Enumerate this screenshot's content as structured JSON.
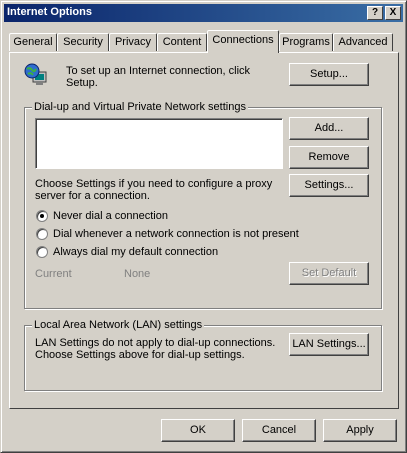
{
  "window": {
    "title": "Internet Options",
    "help_btn": "?",
    "close_btn": "X"
  },
  "tabs": [
    "General",
    "Security",
    "Privacy",
    "Content",
    "Connections",
    "Programs",
    "Advanced"
  ],
  "active_tab": "Connections",
  "setup": {
    "text": "To set up an Internet connection, click Setup.",
    "line1": "To set up an Internet connection, click",
    "line2": "Setup.",
    "button": "Setup...",
    "icon": "globe-computer-icon"
  },
  "dialup": {
    "group_label": "Dial-up and Virtual Private Network settings",
    "buttons": {
      "add": "Add...",
      "remove": "Remove",
      "settings": "Settings...",
      "set_default": "Set Default"
    },
    "choose_line1": "Choose Settings if you need to configure a proxy",
    "choose_line2": "server for a connection.",
    "options": [
      "Never dial a connection",
      "Dial whenever a network connection is not present",
      "Always dial my default connection"
    ],
    "selected_option": "Never dial a connection",
    "current_label": "Current",
    "current_value": "None"
  },
  "lan": {
    "group_label": "Local Area Network (LAN) settings",
    "line1": "LAN Settings do not apply to dial-up connections.",
    "line2": "Choose Settings above for dial-up settings.",
    "button": "LAN Settings..."
  },
  "footer": {
    "ok": "OK",
    "cancel": "Cancel",
    "apply": "Apply"
  }
}
